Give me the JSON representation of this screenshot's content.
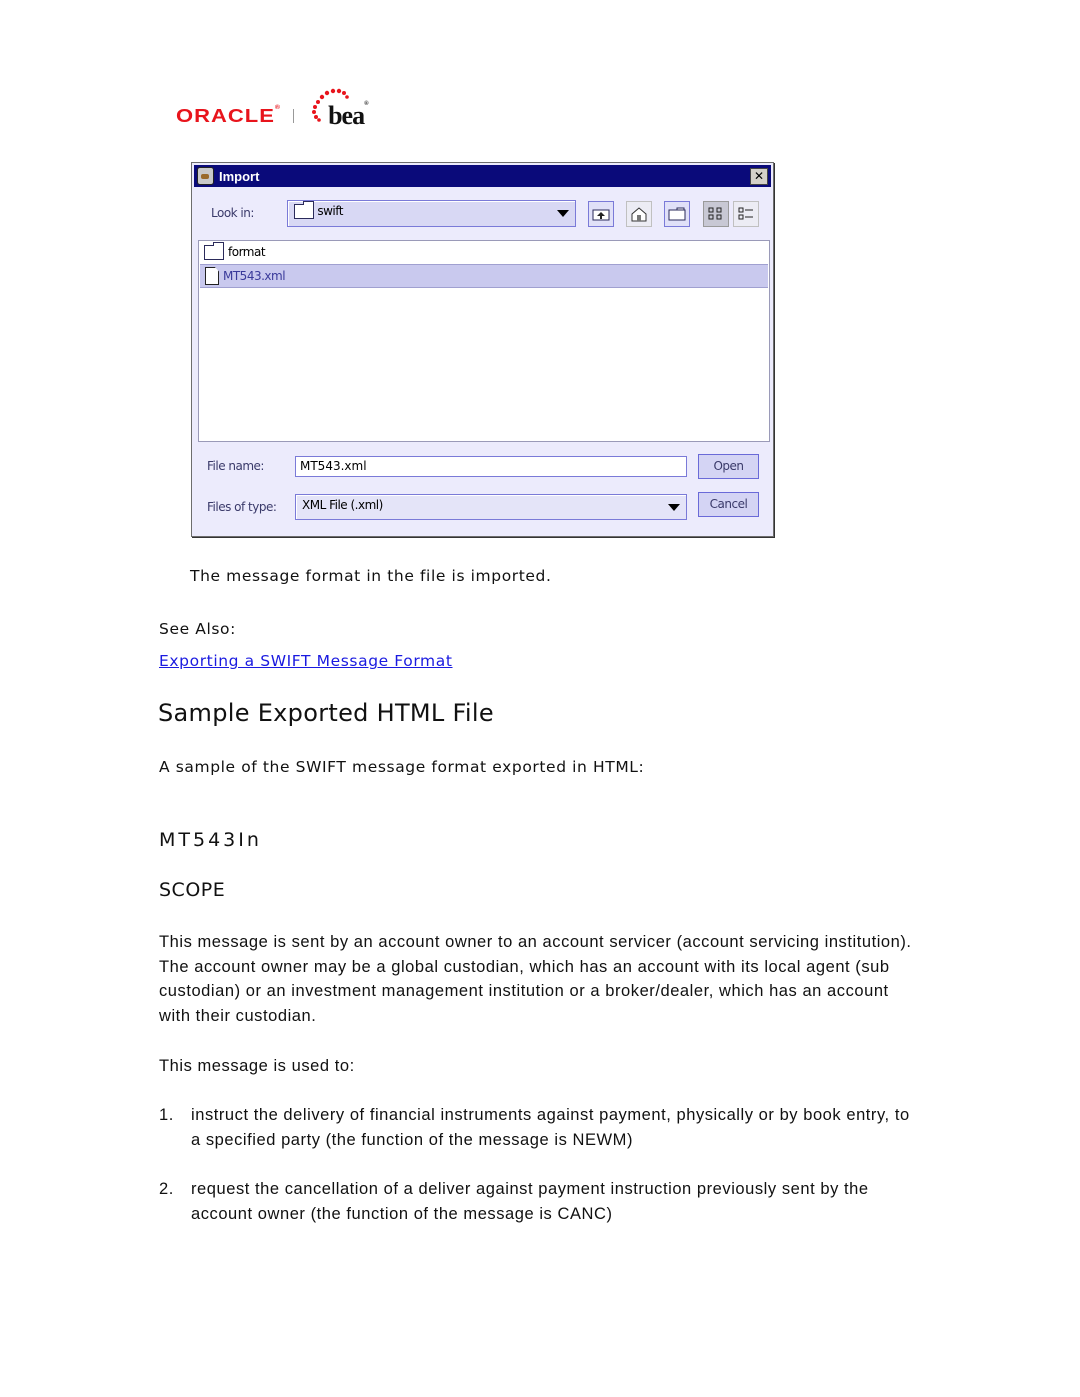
{
  "logo": {
    "brand_left": "ORACLE",
    "brand_right": "bea",
    "brand_color": "#e8141c"
  },
  "dialog": {
    "title": "Import",
    "close_icon": "close-icon",
    "look_in_label": "Look in:",
    "look_in_value": "swift",
    "toolbar_icons": [
      "up-folder-icon",
      "home-icon",
      "new-folder-icon",
      "list-view-icon",
      "details-view-icon"
    ],
    "files": [
      {
        "name": "format",
        "type": "folder",
        "selected": false
      },
      {
        "name": "MT543.xml",
        "type": "file",
        "selected": true
      }
    ],
    "file_name_label": "File name:",
    "file_name_value": "MT543.xml",
    "files_of_type_label": "Files of type:",
    "files_of_type_value": "XML File (.xml)",
    "open_button": "Open",
    "cancel_button": "Cancel",
    "title_bar_color": "#0a0a7a",
    "background_color": "#ecebfc"
  },
  "content": {
    "caption": "The message format in the file is imported.",
    "see_also_label": "See Also:",
    "see_also_link": "Exporting a SWIFT Message Format",
    "section_title": "Sample Exported HTML File",
    "section_intro": "A sample of the SWIFT message format exported in HTML:",
    "message_title": "MT543In",
    "scope_heading": "SCOPE",
    "scope_paragraph": "This message is sent by an account owner to an account servicer (account servicing institution). The account owner may be a global custodian, which has an account with its local agent (sub custodian) or an investment management institution or a broker/dealer, which has an account with their custodian.",
    "used_to_label": "This message is used to:",
    "uses": [
      {
        "number": "1.",
        "text": "instruct the delivery of financial instruments against payment, physically or by book entry, to a specified party (the function of the message is NEWM)"
      },
      {
        "number": "2.",
        "text": "request the cancellation of a deliver against payment instruction previously sent by the account owner (the function of the message is CANC)"
      }
    ],
    "link_color": "#1a1ae0"
  }
}
